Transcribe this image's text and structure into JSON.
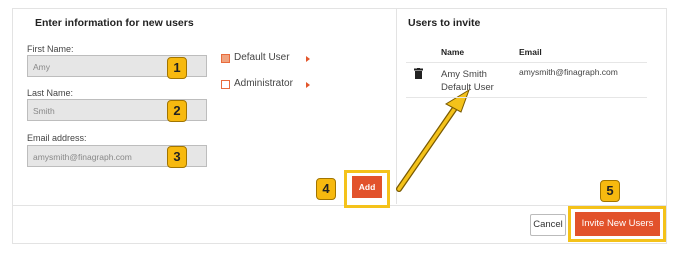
{
  "left": {
    "heading": "Enter information for new users",
    "first_name": {
      "label": "First Name:",
      "value": "Amy",
      "step": "1"
    },
    "last_name": {
      "label": "Last Name:",
      "value": "Smith",
      "step": "2"
    },
    "email": {
      "label": "Email address:",
      "value": "amysmith@finagraph.com",
      "step": "3"
    },
    "roles": [
      {
        "label": "Default User",
        "checked": true
      },
      {
        "label": "Administrator",
        "checked": false
      }
    ],
    "add_button": "Add",
    "add_step": "4"
  },
  "right": {
    "heading": "Users to invite",
    "columns": {
      "name": "Name",
      "email": "Email"
    },
    "rows": [
      {
        "name": "Amy Smith",
        "role": "Default User",
        "email": "amysmith@finagraph.com"
      }
    ]
  },
  "footer": {
    "cancel": "Cancel",
    "invite": "Invite New Users",
    "invite_step": "5"
  },
  "colors": {
    "accent": "#e2522b",
    "callout": "#f7b90f",
    "highlight": "#f4c21a"
  }
}
